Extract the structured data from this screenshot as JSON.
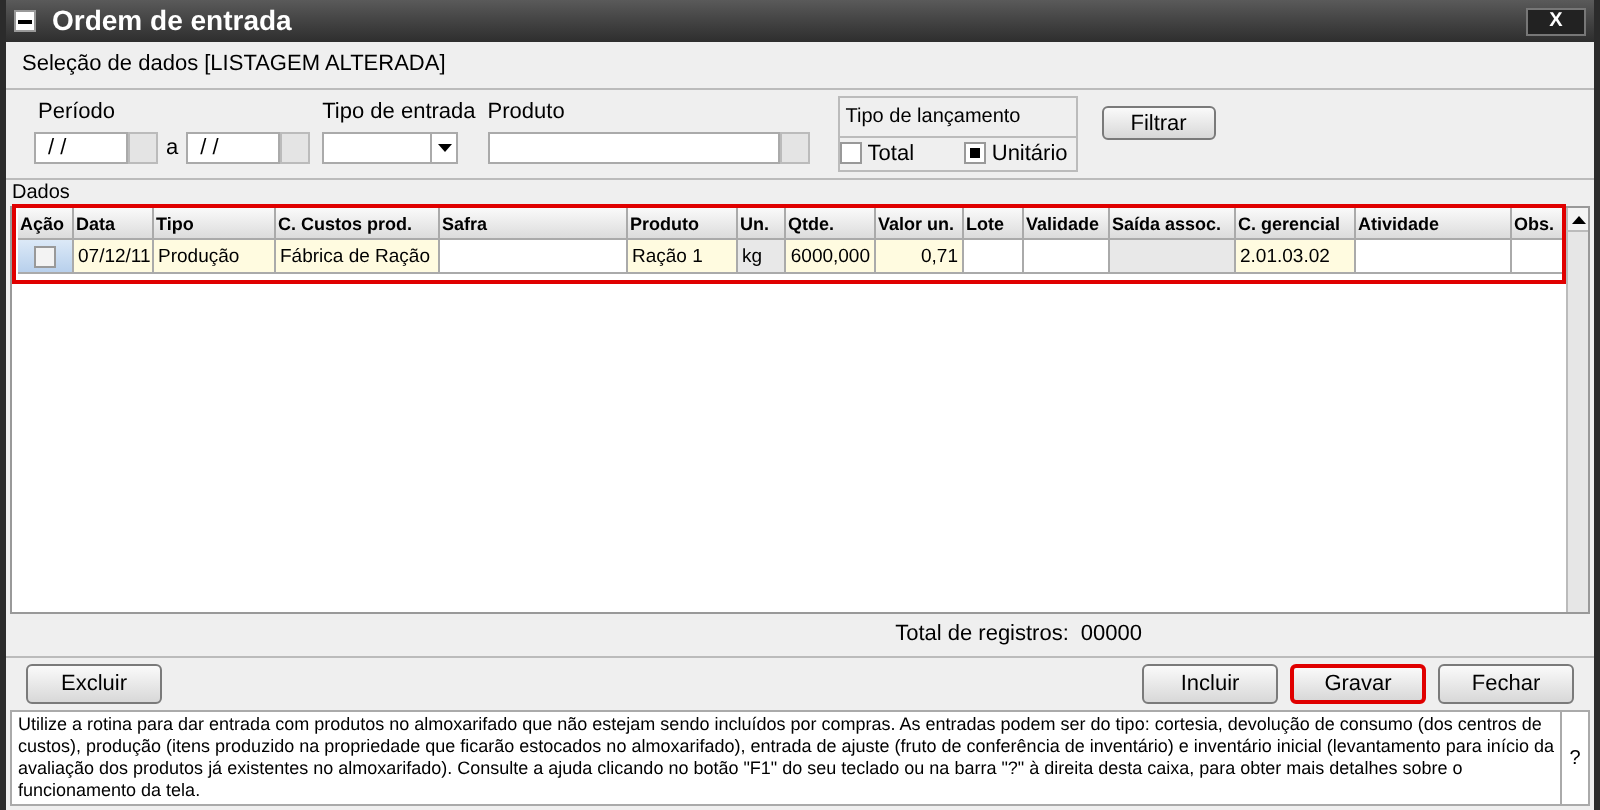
{
  "window": {
    "title": "Ordem de entrada",
    "close": "X"
  },
  "selection": {
    "title": "Seleção de dados [LISTAGEM ALTERADA]",
    "periodo": {
      "label": "Período",
      "from": "/ /",
      "separator": "a",
      "to": "/ /"
    },
    "tipo_entrada": {
      "label": "Tipo de entrada"
    },
    "produto": {
      "label": "Produto"
    },
    "tipo_lancamento": {
      "label": "Tipo de lançamento",
      "options": [
        {
          "label": "Total",
          "checked": false
        },
        {
          "label": "Unitário",
          "checked": true
        }
      ]
    },
    "filter_button": "Filtrar"
  },
  "table": {
    "label": "Dados",
    "highlighted": true,
    "columns": [
      "Ação",
      "Data",
      "Tipo",
      "C. Custos prod.",
      "Safra",
      "Produto",
      "Un.",
      "Qtde.",
      "Valor un.",
      "Lote",
      "Validade",
      "Saída assoc.",
      "C. gerencial",
      "Atividade",
      "Obs."
    ],
    "rows": [
      {
        "cells": [
          {
            "kind": "check",
            "checked": false
          },
          {
            "kind": "filled",
            "text": "07/12/11"
          },
          {
            "kind": "filled",
            "text": "Produção"
          },
          {
            "kind": "filled",
            "text": "Fábrica de Ração"
          },
          {
            "kind": "empty"
          },
          {
            "kind": "filled",
            "text": "Ração 1"
          },
          {
            "kind": "readonly",
            "text": "kg"
          },
          {
            "kind": "filled",
            "text": "6000,000"
          },
          {
            "kind": "filled",
            "text": "0,71"
          },
          {
            "kind": "empty"
          },
          {
            "kind": "empty"
          },
          {
            "kind": "readonly"
          },
          {
            "kind": "filled",
            "text": "2.01.03.02"
          },
          {
            "kind": "empty"
          },
          {
            "kind": "empty"
          }
        ]
      }
    ]
  },
  "total": {
    "label": "Total de registros:",
    "value": "00000"
  },
  "buttons": [
    {
      "label": "Excluir",
      "highlighted": false
    },
    {
      "label": "Incluir",
      "highlighted": false
    },
    {
      "label": "Gravar",
      "highlighted": true
    },
    {
      "label": "Fechar",
      "highlighted": false
    }
  ],
  "help": {
    "text": "Utilize a rotina para dar entrada com produtos no almoxarifado que não estejam sendo incluídos por compras. As entradas podem ser do tipo: cortesia, devolução de consumo (dos centros de custos), produção (itens produzido na propriedade que ficarão estocados no almoxarifado), entrada de ajuste (fruto de conferência de inventário) e inventário inicial (levantamento para início da avaliação dos produtos já existentes no almoxarifado). Consulte a ajuda clicando no botão \"F1\" do seu teclado ou na barra \"?\" à direita desta caixa, para obter mais detalhes sobre o funcionamento da tela.",
    "question": "?"
  }
}
